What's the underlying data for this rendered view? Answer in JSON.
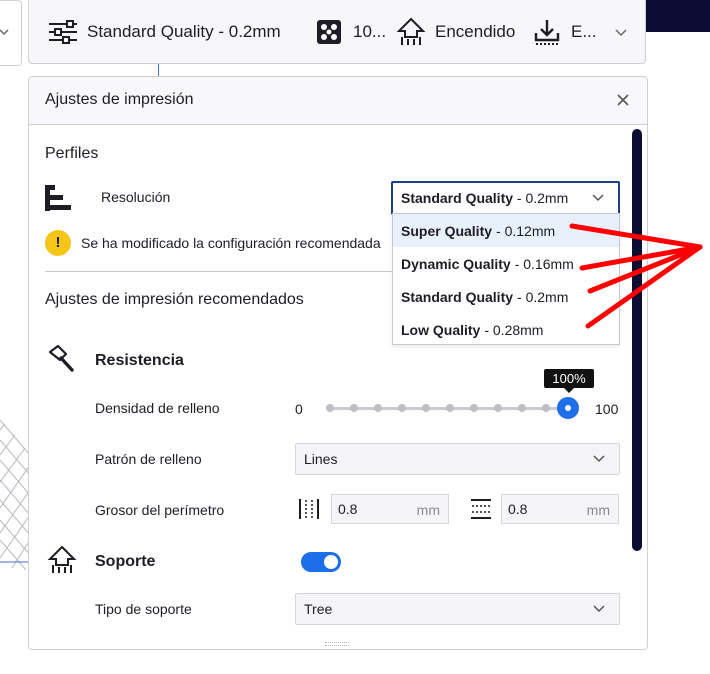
{
  "header": {
    "profile_label": "Standard Quality - 0.2mm",
    "infill_label": "10...",
    "support_label": "Encendido",
    "adhesion_label": "E..."
  },
  "panel": {
    "title": "Ajustes de impresión",
    "profiles": {
      "section_title": "Perfiles",
      "resolution_label": "Resolución",
      "selected": {
        "name": "Standard Quality",
        "detail": " - 0.2mm"
      },
      "options": [
        {
          "name": "Super Quality",
          "detail": "- 0.12mm"
        },
        {
          "name": "Dynamic Quality",
          "detail": "- 0.16mm"
        },
        {
          "name": "Standard Quality",
          "detail": "- 0.2mm"
        },
        {
          "name": "Low Quality",
          "detail": "- 0.28mm"
        }
      ],
      "warning_text": "Se ha modificado la configuración recomendada",
      "warning_symbol": "!"
    },
    "recommended": {
      "section_title": "Ajustes de impresión recomendados",
      "strength": {
        "title": "Resistencia",
        "infill_density_label": "Densidad de relleno",
        "slider_min": "0",
        "slider_max": "100",
        "slider_value_label": "100%",
        "slider_value": 100,
        "infill_pattern_label": "Patrón de relleno",
        "infill_pattern_value": "Lines",
        "wall_thickness_label": "Grosor del perímetro",
        "wall_value": "0.8",
        "wall_unit": "mm",
        "topbottom_value": "0.8",
        "topbottom_unit": "mm"
      },
      "support": {
        "title": "Soporte",
        "enabled": true,
        "type_label": "Tipo de soporte",
        "type_value": "Tree"
      }
    }
  },
  "colors": {
    "accent": "#1c6fe8",
    "dark_navy": "#0c0d33",
    "warning": "#f5c518",
    "annotation_arrow": "#ff0000"
  }
}
